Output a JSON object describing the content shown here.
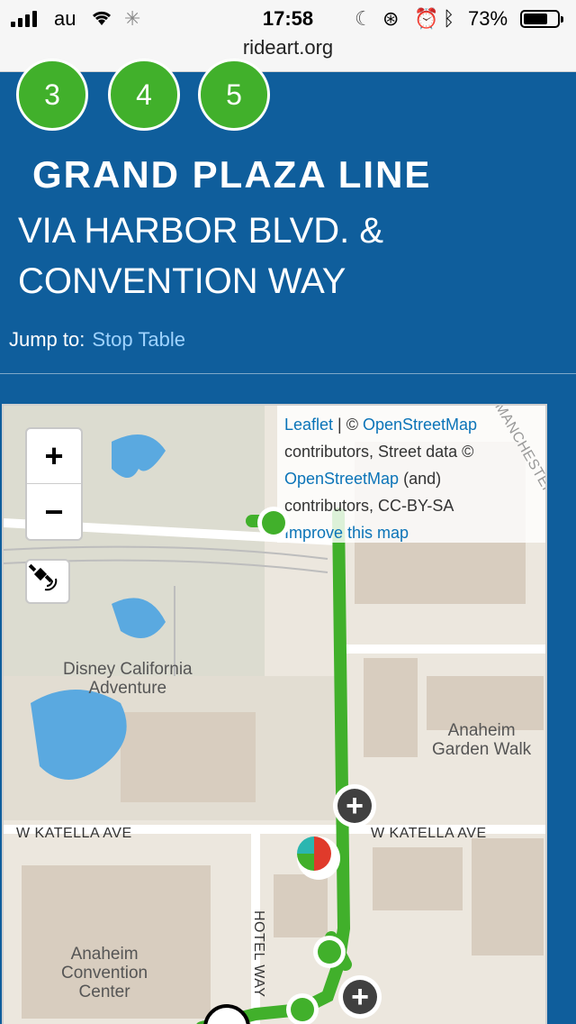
{
  "status_bar": {
    "carrier": "au",
    "time": "17:58",
    "battery_percent": "73%",
    "battery_level": 0.73,
    "url": "rideart.org"
  },
  "route_numbers": [
    "3",
    "4",
    "5"
  ],
  "line": {
    "title": "GRAND PLAZA LINE",
    "subtitle_line1": "VIA HARBOR BLVD. &",
    "subtitle_line2": "CONVENTION WAY"
  },
  "jump": {
    "label": "Jump to:",
    "link": "Stop Table"
  },
  "map": {
    "zoom_in": "+",
    "zoom_out": "−",
    "attribution": {
      "leaflet": "Leaflet",
      "sep": " | © ",
      "osm": "OpenStreetMap",
      "line2": "contributors, Street data ©",
      "osm2": "OpenStreetMap",
      "line3_rest": " (and)",
      "line4": "contributors, CC-BY-SA",
      "improve": "Improve this map"
    },
    "labels": {
      "dca_line1": "Disney California",
      "dca_line2": "Adventure",
      "garden_line1": "Anaheim",
      "garden_line2": "Garden Walk",
      "convention_line1": "Anaheim",
      "convention_line2": "Convention",
      "convention_line3": "Center",
      "katella_left": "W KATELLA AVE",
      "katella_right": "W KATELLA AVE",
      "hotel_way": "HOTEL WAY",
      "manchester": "MANCHESTER",
      "plus": "+"
    },
    "colors": {
      "route": "#41b02b",
      "water": "#5aa9e0"
    }
  }
}
